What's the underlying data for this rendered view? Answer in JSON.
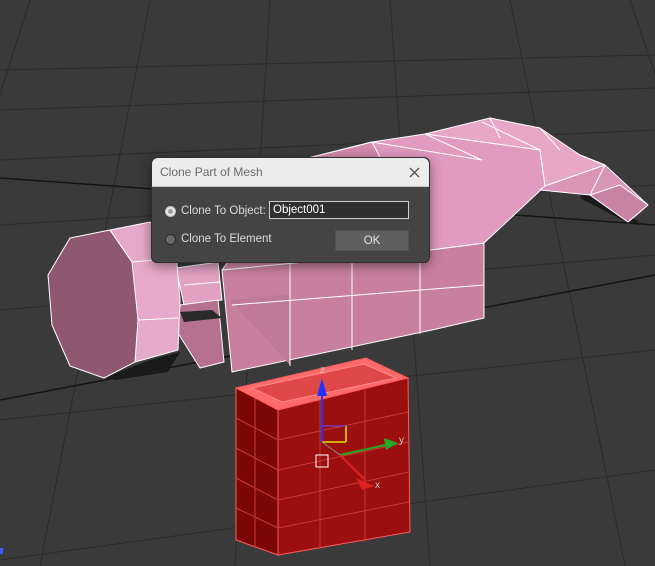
{
  "dialog": {
    "title": "Clone Part of Mesh",
    "option_object_label": "Clone To Object:",
    "option_element_label": "Clone To Element",
    "object_name_value": "Object001",
    "ok_label": "OK",
    "selected_option": "Clone To Object"
  },
  "viewport": {
    "gizmo_axis_x": "x",
    "gizmo_axis_y": "y",
    "gizmo_axis_z": "z",
    "background_color": "#3a3a3a",
    "mesh_color": "#d98fb3",
    "selection_color": "#9c0f0f"
  }
}
